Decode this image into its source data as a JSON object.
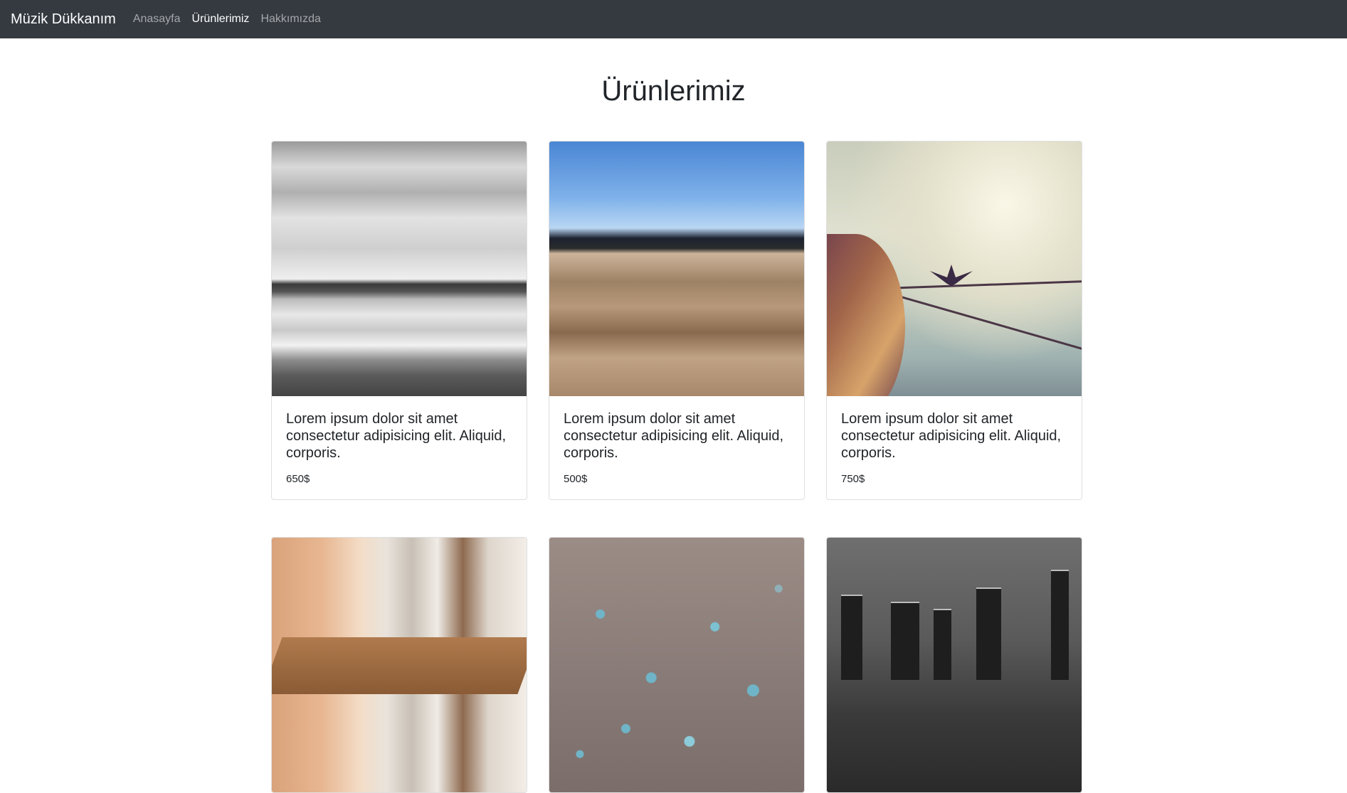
{
  "navbar": {
    "brand": "Müzik Dükkanım",
    "links": [
      {
        "label": "Anasayfa",
        "active": false
      },
      {
        "label": "Ürünlerimiz",
        "active": true
      },
      {
        "label": "Hakkımızda",
        "active": false
      }
    ]
  },
  "page": {
    "title": "Ürünlerimiz"
  },
  "products": [
    {
      "image": "beach-photo",
      "title": "Lorem ipsum dolor sit amet consectetur adipisicing elit. Aliquid, corporis.",
      "price": "650$"
    },
    {
      "image": "dock-photo",
      "title": "Lorem ipsum dolor sit amet consectetur adipisicing elit. Aliquid, corporis.",
      "price": "500$"
    },
    {
      "image": "boat-bird-photo",
      "title": "Lorem ipsum dolor sit amet consectetur adipisicing elit. Aliquid, corporis.",
      "price": "750$"
    },
    {
      "image": "cafe-photo"
    },
    {
      "image": "water-drops-photo"
    },
    {
      "image": "city-bridge-photo"
    }
  ],
  "colors": {
    "navbar_bg": "#343a40",
    "nav_active": "#ffffff",
    "nav_inactive": "rgba(255,255,255,0.55)"
  }
}
